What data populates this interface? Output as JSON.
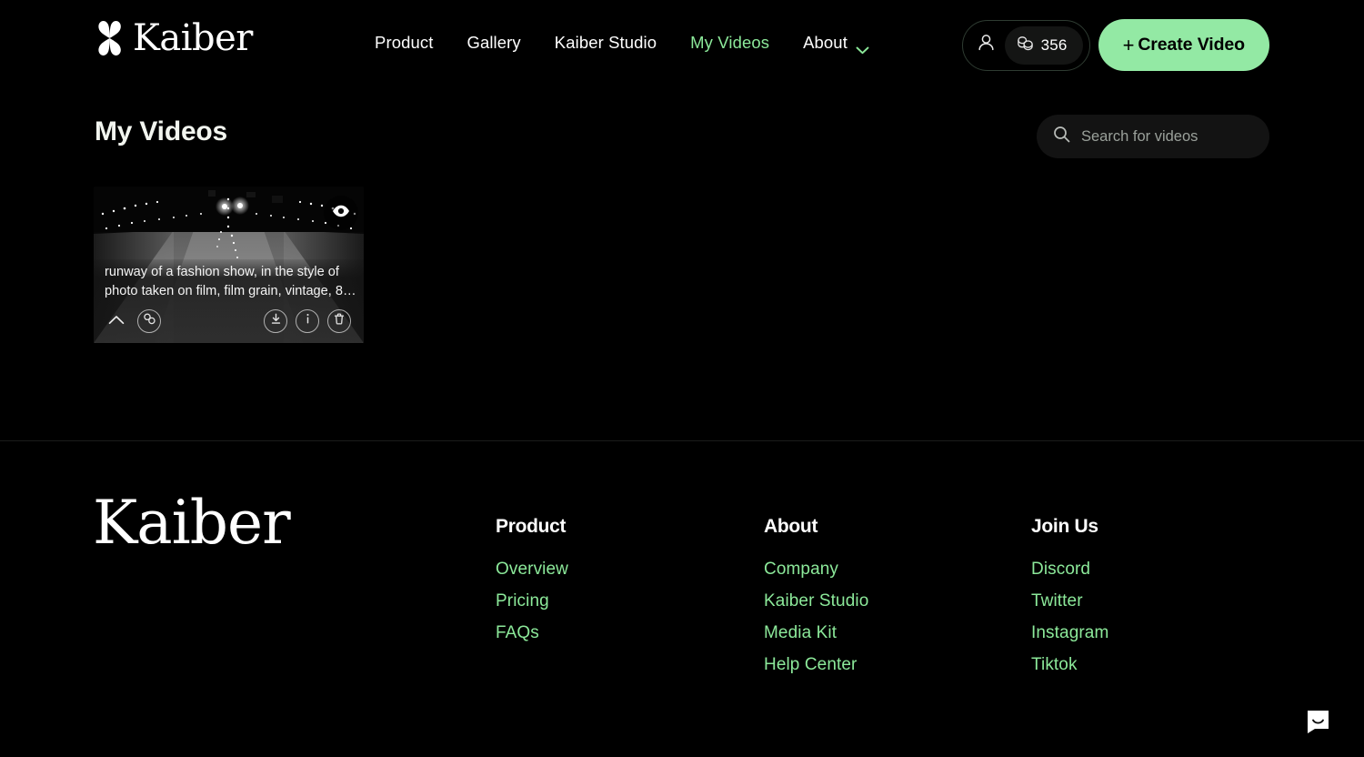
{
  "brand": {
    "name": "Kaiber",
    "logo_icon": "kaiber-k-mark",
    "accent_green": "#8ce99a",
    "button_green": "#93e9a4",
    "background": "#000000"
  },
  "header": {
    "nav": [
      {
        "label": "Product",
        "active": false
      },
      {
        "label": "Gallery",
        "active": false
      },
      {
        "label": "Kaiber Studio",
        "active": false
      },
      {
        "label": "My Videos",
        "active": true
      },
      {
        "label": "About",
        "active": false,
        "icon": "chevron-down-icon"
      }
    ],
    "account": {
      "user_icon": "user-icon",
      "credits_icon": "coins-icon",
      "credits": "356"
    },
    "create_button": {
      "plus": "+",
      "label": "Create Video"
    }
  },
  "main": {
    "title": "My Videos",
    "search": {
      "icon": "search-icon",
      "placeholder": "Search for videos",
      "value": ""
    },
    "videos": [
      {
        "caption": "runway of a fashion show, in the style of photo taken on film, film grain, vintage, 8…",
        "preview_icon": "eye-icon",
        "actions": {
          "collapse": "chevron-up-icon",
          "duplicate": "copy-icon",
          "download": "download-icon",
          "info": "info-icon",
          "delete": "trash-icon"
        }
      }
    ]
  },
  "footer": {
    "wordmark": "Kaiber",
    "columns": [
      {
        "heading": "Product",
        "links": [
          "Overview",
          "Pricing",
          "FAQs"
        ]
      },
      {
        "heading": "About",
        "links": [
          "Company",
          "Kaiber Studio",
          "Media Kit",
          "Help Center"
        ]
      },
      {
        "heading": "Join Us",
        "links": [
          "Discord",
          "Twitter",
          "Instagram",
          "Tiktok"
        ]
      }
    ]
  },
  "chat_widget": {
    "icon": "chat-bubble-icon"
  }
}
